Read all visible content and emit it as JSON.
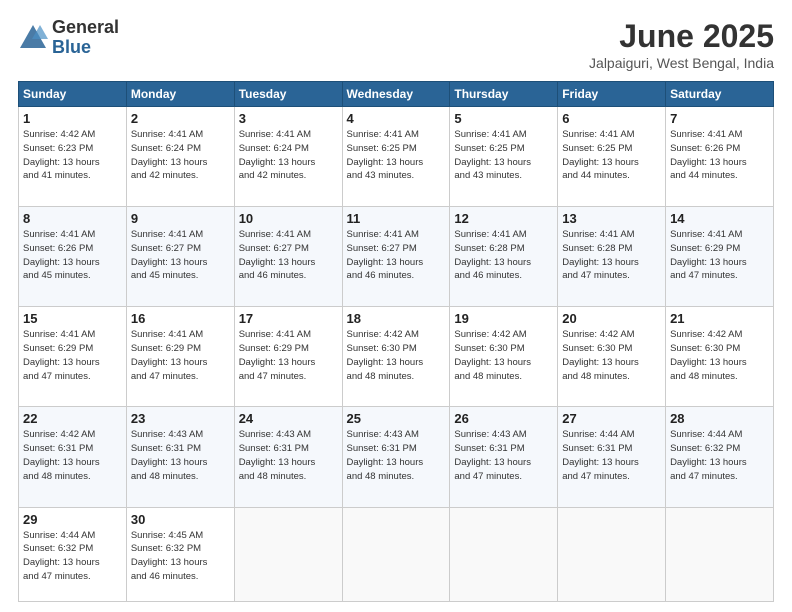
{
  "header": {
    "logo_general": "General",
    "logo_blue": "Blue",
    "title": "June 2025",
    "location": "Jalpaiguri, West Bengal, India"
  },
  "weekdays": [
    "Sunday",
    "Monday",
    "Tuesday",
    "Wednesday",
    "Thursday",
    "Friday",
    "Saturday"
  ],
  "weeks": [
    [
      {
        "day": "1",
        "info": "Sunrise: 4:42 AM\nSunset: 6:23 PM\nDaylight: 13 hours\nand 41 minutes."
      },
      {
        "day": "2",
        "info": "Sunrise: 4:41 AM\nSunset: 6:24 PM\nDaylight: 13 hours\nand 42 minutes."
      },
      {
        "day": "3",
        "info": "Sunrise: 4:41 AM\nSunset: 6:24 PM\nDaylight: 13 hours\nand 42 minutes."
      },
      {
        "day": "4",
        "info": "Sunrise: 4:41 AM\nSunset: 6:25 PM\nDaylight: 13 hours\nand 43 minutes."
      },
      {
        "day": "5",
        "info": "Sunrise: 4:41 AM\nSunset: 6:25 PM\nDaylight: 13 hours\nand 43 minutes."
      },
      {
        "day": "6",
        "info": "Sunrise: 4:41 AM\nSunset: 6:25 PM\nDaylight: 13 hours\nand 44 minutes."
      },
      {
        "day": "7",
        "info": "Sunrise: 4:41 AM\nSunset: 6:26 PM\nDaylight: 13 hours\nand 44 minutes."
      }
    ],
    [
      {
        "day": "8",
        "info": "Sunrise: 4:41 AM\nSunset: 6:26 PM\nDaylight: 13 hours\nand 45 minutes."
      },
      {
        "day": "9",
        "info": "Sunrise: 4:41 AM\nSunset: 6:27 PM\nDaylight: 13 hours\nand 45 minutes."
      },
      {
        "day": "10",
        "info": "Sunrise: 4:41 AM\nSunset: 6:27 PM\nDaylight: 13 hours\nand 46 minutes."
      },
      {
        "day": "11",
        "info": "Sunrise: 4:41 AM\nSunset: 6:27 PM\nDaylight: 13 hours\nand 46 minutes."
      },
      {
        "day": "12",
        "info": "Sunrise: 4:41 AM\nSunset: 6:28 PM\nDaylight: 13 hours\nand 46 minutes."
      },
      {
        "day": "13",
        "info": "Sunrise: 4:41 AM\nSunset: 6:28 PM\nDaylight: 13 hours\nand 47 minutes."
      },
      {
        "day": "14",
        "info": "Sunrise: 4:41 AM\nSunset: 6:29 PM\nDaylight: 13 hours\nand 47 minutes."
      }
    ],
    [
      {
        "day": "15",
        "info": "Sunrise: 4:41 AM\nSunset: 6:29 PM\nDaylight: 13 hours\nand 47 minutes."
      },
      {
        "day": "16",
        "info": "Sunrise: 4:41 AM\nSunset: 6:29 PM\nDaylight: 13 hours\nand 47 minutes."
      },
      {
        "day": "17",
        "info": "Sunrise: 4:41 AM\nSunset: 6:29 PM\nDaylight: 13 hours\nand 47 minutes."
      },
      {
        "day": "18",
        "info": "Sunrise: 4:42 AM\nSunset: 6:30 PM\nDaylight: 13 hours\nand 48 minutes."
      },
      {
        "day": "19",
        "info": "Sunrise: 4:42 AM\nSunset: 6:30 PM\nDaylight: 13 hours\nand 48 minutes."
      },
      {
        "day": "20",
        "info": "Sunrise: 4:42 AM\nSunset: 6:30 PM\nDaylight: 13 hours\nand 48 minutes."
      },
      {
        "day": "21",
        "info": "Sunrise: 4:42 AM\nSunset: 6:30 PM\nDaylight: 13 hours\nand 48 minutes."
      }
    ],
    [
      {
        "day": "22",
        "info": "Sunrise: 4:42 AM\nSunset: 6:31 PM\nDaylight: 13 hours\nand 48 minutes."
      },
      {
        "day": "23",
        "info": "Sunrise: 4:43 AM\nSunset: 6:31 PM\nDaylight: 13 hours\nand 48 minutes."
      },
      {
        "day": "24",
        "info": "Sunrise: 4:43 AM\nSunset: 6:31 PM\nDaylight: 13 hours\nand 48 minutes."
      },
      {
        "day": "25",
        "info": "Sunrise: 4:43 AM\nSunset: 6:31 PM\nDaylight: 13 hours\nand 48 minutes."
      },
      {
        "day": "26",
        "info": "Sunrise: 4:43 AM\nSunset: 6:31 PM\nDaylight: 13 hours\nand 47 minutes."
      },
      {
        "day": "27",
        "info": "Sunrise: 4:44 AM\nSunset: 6:31 PM\nDaylight: 13 hours\nand 47 minutes."
      },
      {
        "day": "28",
        "info": "Sunrise: 4:44 AM\nSunset: 6:32 PM\nDaylight: 13 hours\nand 47 minutes."
      }
    ],
    [
      {
        "day": "29",
        "info": "Sunrise: 4:44 AM\nSunset: 6:32 PM\nDaylight: 13 hours\nand 47 minutes."
      },
      {
        "day": "30",
        "info": "Sunrise: 4:45 AM\nSunset: 6:32 PM\nDaylight: 13 hours\nand 46 minutes."
      },
      {
        "day": "",
        "info": ""
      },
      {
        "day": "",
        "info": ""
      },
      {
        "day": "",
        "info": ""
      },
      {
        "day": "",
        "info": ""
      },
      {
        "day": "",
        "info": ""
      }
    ]
  ]
}
